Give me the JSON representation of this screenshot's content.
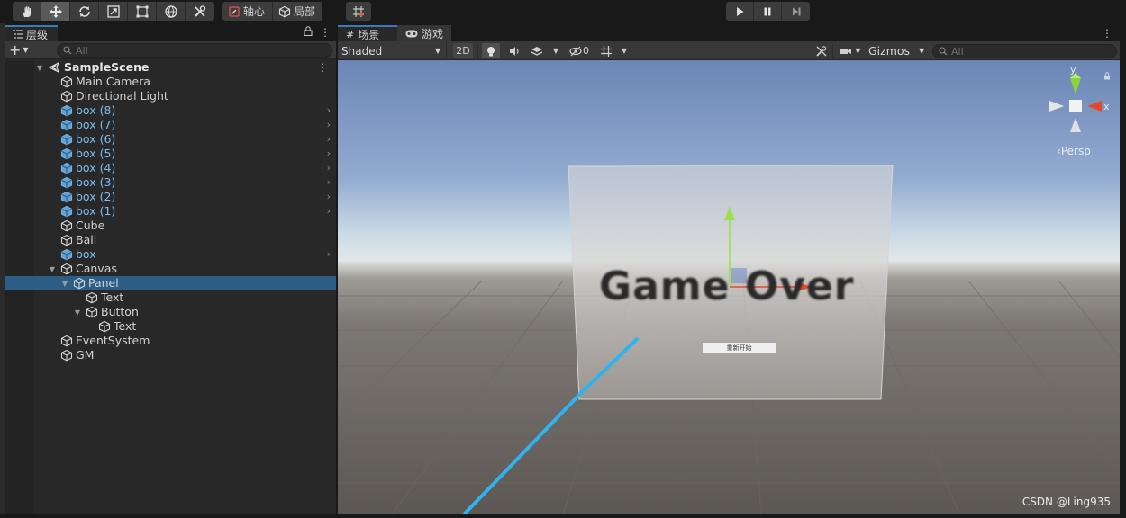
{
  "toolbar": {
    "tools": [
      "hand-tool",
      "move-tool",
      "rotate-tool",
      "scale-tool",
      "rect-tool",
      "transform-tool",
      "custom-tool"
    ],
    "pivot_label": "轴心",
    "local_label": "局部",
    "grid_snap": "grid-snap-tool",
    "play_controls": [
      "play",
      "pause",
      "step"
    ]
  },
  "hierarchy": {
    "tab_label": "层级",
    "search_placeholder": "All",
    "scene_name": "SampleScene",
    "items": [
      {
        "label": "Main Camera",
        "depth": 1,
        "prefab": false
      },
      {
        "label": "Directional Light",
        "depth": 1,
        "prefab": false
      },
      {
        "label": "box (8)",
        "depth": 1,
        "prefab": true
      },
      {
        "label": "box (7)",
        "depth": 1,
        "prefab": true
      },
      {
        "label": "box (6)",
        "depth": 1,
        "prefab": true
      },
      {
        "label": "box (5)",
        "depth": 1,
        "prefab": true
      },
      {
        "label": "box (4)",
        "depth": 1,
        "prefab": true
      },
      {
        "label": "box (3)",
        "depth": 1,
        "prefab": true
      },
      {
        "label": "box (2)",
        "depth": 1,
        "prefab": true
      },
      {
        "label": "box (1)",
        "depth": 1,
        "prefab": true
      },
      {
        "label": "Cube",
        "depth": 1,
        "prefab": false
      },
      {
        "label": "Ball",
        "depth": 1,
        "prefab": false
      },
      {
        "label": "box",
        "depth": 1,
        "prefab": true
      },
      {
        "label": "Canvas",
        "depth": 1,
        "prefab": false,
        "expanded": true
      },
      {
        "label": "Panel",
        "depth": 2,
        "prefab": false,
        "expanded": true,
        "selected": true
      },
      {
        "label": "Text",
        "depth": 3,
        "prefab": false
      },
      {
        "label": "Button",
        "depth": 3,
        "prefab": false,
        "expanded": true
      },
      {
        "label": "Text",
        "depth": 4,
        "prefab": false
      },
      {
        "label": "EventSystem",
        "depth": 1,
        "prefab": false
      },
      {
        "label": "GM",
        "depth": 1,
        "prefab": false
      }
    ]
  },
  "scene_view": {
    "tab_scene": "场景",
    "tab_game": "游戏",
    "shading_mode": "Shaded",
    "mode_2d": "2D",
    "hidden_count": "0",
    "gizmos_label": "Gizmos",
    "search_placeholder": "All",
    "persp_label": "Persp",
    "axis_y": "y",
    "axis_x": "x",
    "game_over_text": "Game Over",
    "restart_button": "重新开始",
    "watermark": "CSDN @Ling935"
  },
  "colors": {
    "selection": "#2c5d87",
    "prefab_text": "#7ebcf0",
    "tab_accent": "#3a79bb",
    "panel_bg": "#282828"
  }
}
